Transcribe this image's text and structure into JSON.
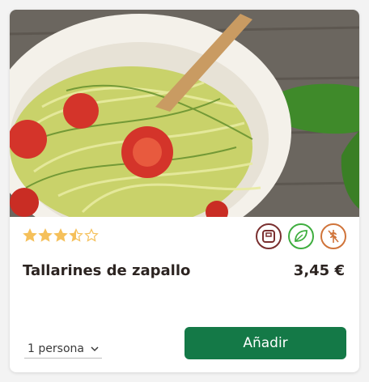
{
  "product": {
    "image_alt": "Tallarines de zapallo",
    "rating": 3.5,
    "rating_max": 5,
    "badges": [
      {
        "icon": "scale-icon",
        "color": "#7a2f2f"
      },
      {
        "icon": "leaf-icon",
        "color": "#3fae3f"
      },
      {
        "icon": "wheat-free-icon",
        "color": "#d0743a"
      }
    ],
    "title": "Tallarines de zapallo",
    "price": "3,45 €"
  },
  "controls": {
    "portion_label": "1 persona",
    "add_label": "Añadir"
  },
  "colors": {
    "star": "#f5c05a",
    "button": "#147947",
    "text": "#2c2421"
  }
}
